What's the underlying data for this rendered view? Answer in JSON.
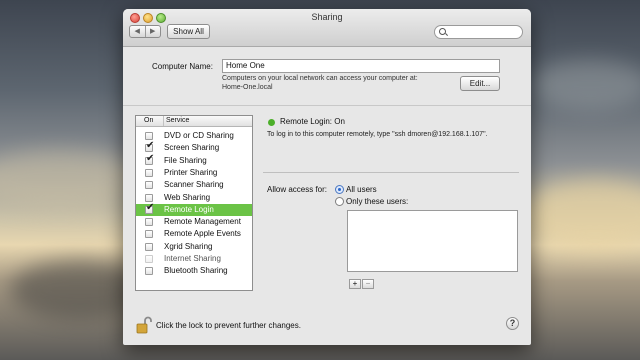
{
  "window": {
    "title": "Sharing"
  },
  "toolbar": {
    "back_icon": "◀",
    "forward_icon": "▶",
    "show_all_label": "Show All",
    "search_placeholder": ""
  },
  "computer": {
    "name_label": "Computer Name:",
    "name_value": "Home One",
    "info_line1": "Computers on your local network can access your computer at:",
    "info_line2": "Home-One.local",
    "edit_label": "Edit..."
  },
  "services": {
    "header_on": "On",
    "header_service": "Service",
    "items": [
      {
        "label": "DVD or CD Sharing",
        "checked": false
      },
      {
        "label": "Screen Sharing",
        "checked": true
      },
      {
        "label": "File Sharing",
        "checked": true
      },
      {
        "label": "Printer Sharing",
        "checked": false
      },
      {
        "label": "Scanner Sharing",
        "checked": false
      },
      {
        "label": "Web Sharing",
        "checked": false
      },
      {
        "label": "Remote Login",
        "checked": true,
        "selected": true
      },
      {
        "label": "Remote Management",
        "checked": false
      },
      {
        "label": "Remote Apple Events",
        "checked": false
      },
      {
        "label": "Xgrid Sharing",
        "checked": false
      },
      {
        "label": "Internet Sharing",
        "checked": false,
        "disabled": true
      },
      {
        "label": "Bluetooth Sharing",
        "checked": false
      }
    ]
  },
  "detail": {
    "status": "Remote Login: On",
    "status_color": "#4caf2a",
    "instructions": "To log in to this computer remotely, type \"ssh dmoren@192.168.1.107\".",
    "access_label": "Allow access for:",
    "option_all": "All users",
    "option_some": "Only these users:",
    "add_label": "+",
    "remove_label": "−"
  },
  "footer": {
    "lock_text": "Click the lock to prevent further changes.",
    "help_label": "?"
  },
  "colors": {
    "selection": "#6bc346"
  }
}
